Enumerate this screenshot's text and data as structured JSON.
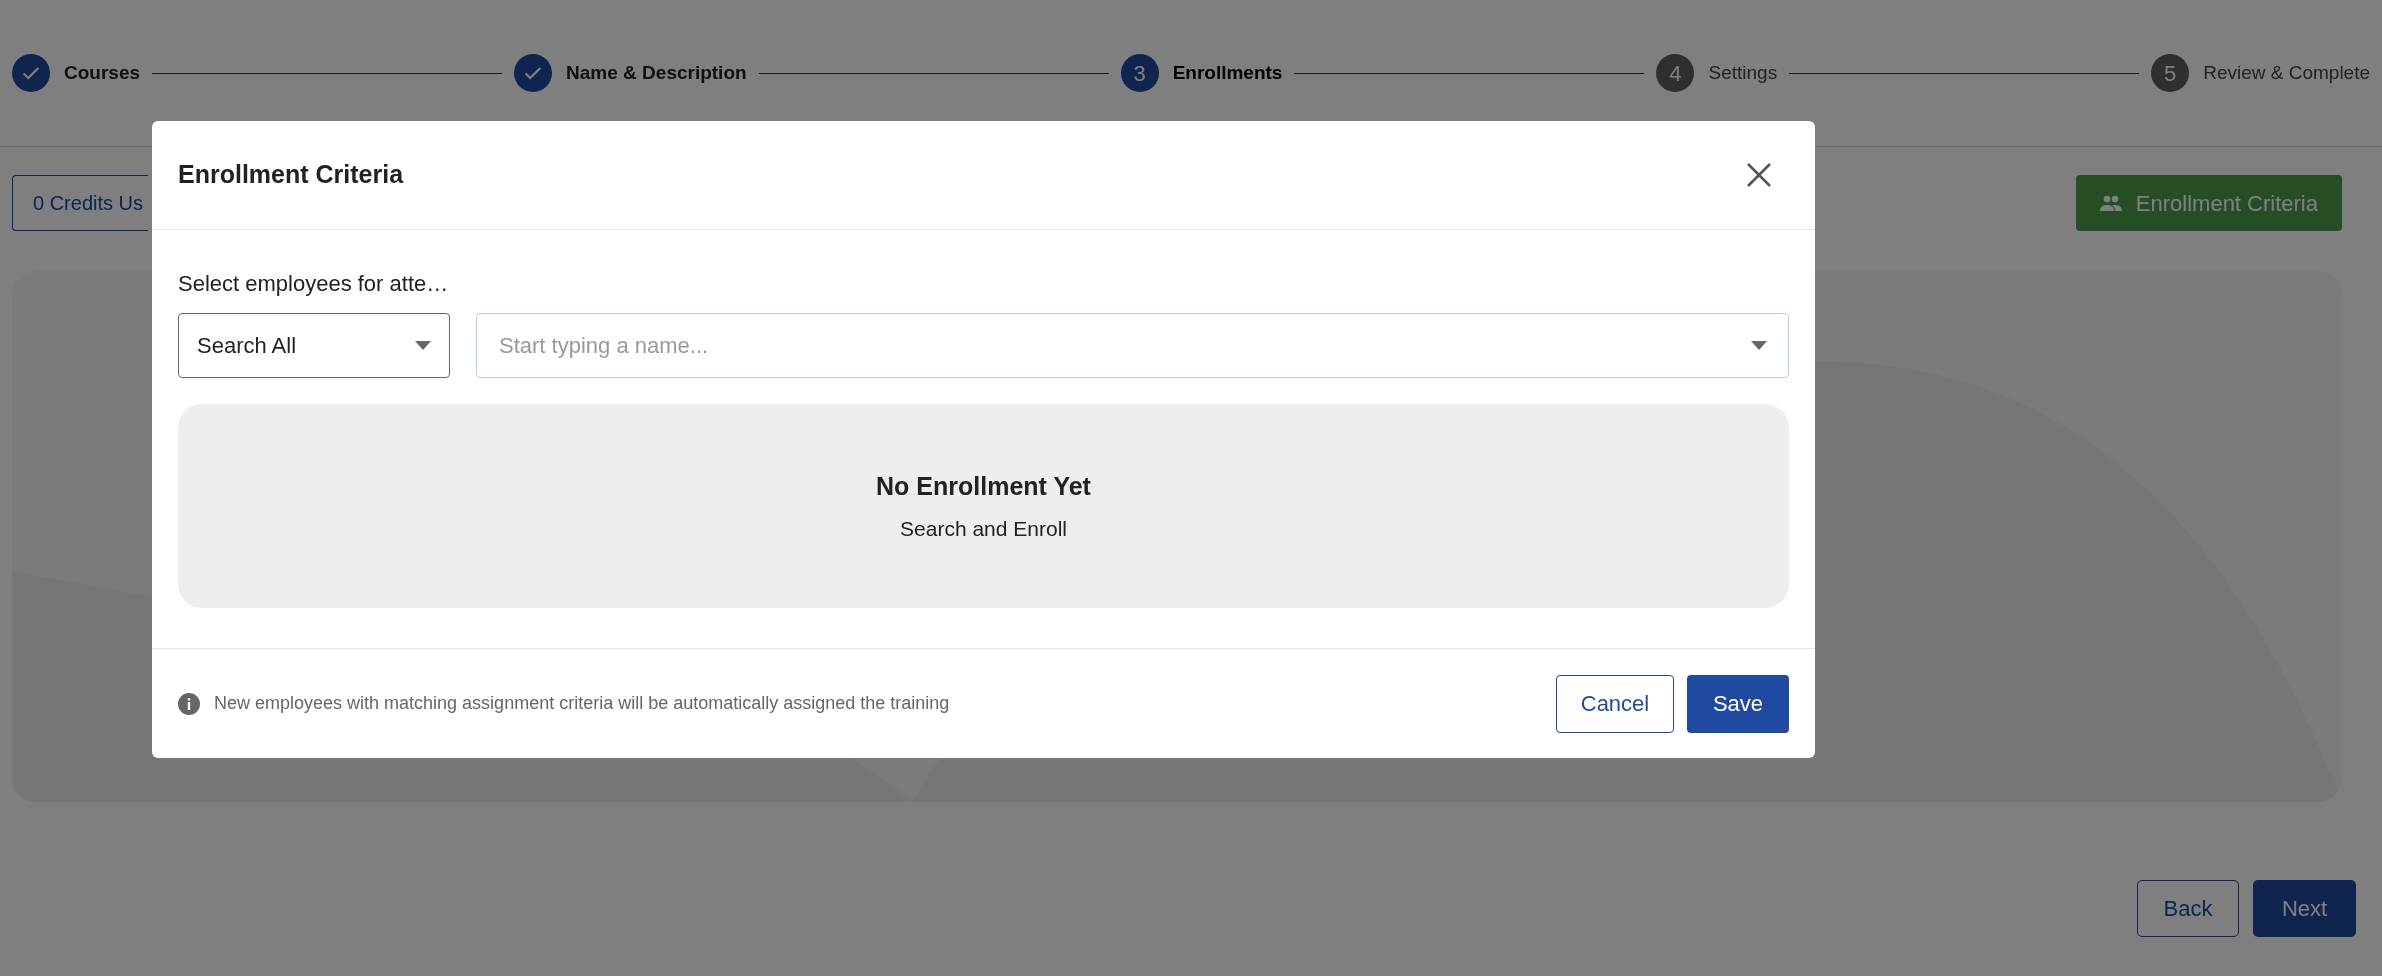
{
  "stepper": [
    {
      "label": "Courses",
      "completed": true,
      "selected": false
    },
    {
      "label": "Name & Description",
      "completed": true,
      "selected": false
    },
    {
      "label": "Enrollments",
      "number": "3",
      "completed": false,
      "selected": true
    },
    {
      "label": "Settings",
      "number": "4",
      "completed": false,
      "selected": false
    },
    {
      "label": "Review & Complete",
      "number": "5",
      "completed": false,
      "selected": false
    }
  ],
  "credits_button": "0 Credits Us",
  "enrollment_criteria_button": "Enrollment Criteria",
  "nav_buttons": {
    "back": "Back",
    "next": "Next"
  },
  "modal": {
    "title": "Enrollment Criteria",
    "field_label": "Select employees for atte…",
    "scope_select": {
      "value": "Search All"
    },
    "name_search": {
      "placeholder": "Start typing a name..."
    },
    "empty_state": {
      "title": "No Enrollment Yet",
      "subtitle": "Search and Enroll"
    },
    "footer_note": "New employees with matching assignment criteria will be automatically assigned the training",
    "cancel": "Cancel",
    "save": "Save"
  }
}
